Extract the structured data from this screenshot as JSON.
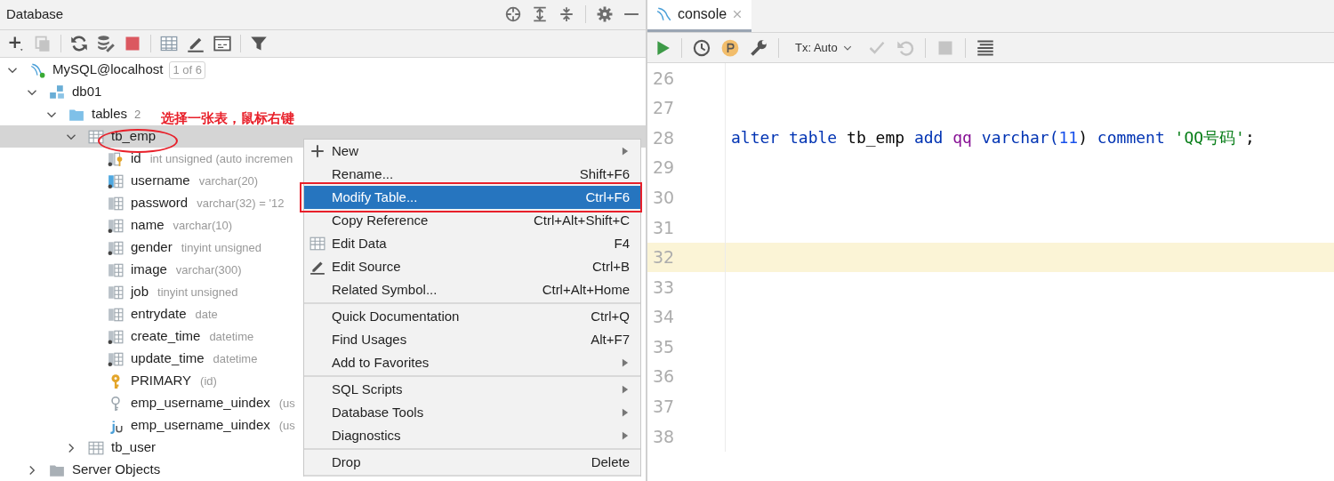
{
  "left_panel": {
    "title": "Database",
    "toolbar": [
      {
        "disabled": false
      },
      {
        "disabled": true
      },
      {
        "disabled": false
      },
      {
        "disabled": false
      },
      {
        "disabled": false
      },
      {
        "disabled": false
      },
      {
        "disabled": false
      },
      {
        "disabled": false
      },
      {
        "disabled": false
      }
    ],
    "tree": [
      {
        "kind": "connection",
        "label": "MySQL@localhost",
        "badge": "1 of 6",
        "expanded": true,
        "selected": false,
        "children": [
          {
            "kind": "schema",
            "label": "db01",
            "expanded": true,
            "selected": false,
            "children": [
              {
                "kind": "folder",
                "label": "tables",
                "count": "2",
                "expanded": true,
                "selected": false,
                "children": [
                  {
                    "kind": "table",
                    "label": "tb_emp",
                    "expanded": true,
                    "selected": true,
                    "children": [
                      {
                        "kind": "pk_column",
                        "label": "id",
                        "detail": "int unsigned (auto incremen",
                        "selected": false
                      },
                      {
                        "kind": "unique_column",
                        "label": "username",
                        "detail": "varchar(20)",
                        "selected": false
                      },
                      {
                        "kind": "column",
                        "label": "password",
                        "detail": "varchar(32) = '12",
                        "selected": false
                      },
                      {
                        "kind": "notnull_column",
                        "label": "name",
                        "detail": "varchar(10)",
                        "selected": false
                      },
                      {
                        "kind": "notnull_column",
                        "label": "gender",
                        "detail": "tinyint unsigned",
                        "selected": false
                      },
                      {
                        "kind": "column",
                        "label": "image",
                        "detail": "varchar(300)",
                        "selected": false
                      },
                      {
                        "kind": "column",
                        "label": "job",
                        "detail": "tinyint unsigned",
                        "selected": false
                      },
                      {
                        "kind": "column",
                        "label": "entrydate",
                        "detail": "date",
                        "selected": false
                      },
                      {
                        "kind": "notnull_column",
                        "label": "create_time",
                        "detail": "datetime",
                        "selected": false
                      },
                      {
                        "kind": "notnull_column",
                        "label": "update_time",
                        "detail": "datetime",
                        "selected": false
                      },
                      {
                        "kind": "primary_key",
                        "label": "PRIMARY",
                        "detail": "(id)",
                        "selected": false
                      },
                      {
                        "kind": "unique_key",
                        "label": "emp_username_uindex",
                        "detail": "(us",
                        "selected": false
                      },
                      {
                        "kind": "unique_index",
                        "label": "emp_username_uindex",
                        "detail": "(us",
                        "selected": false
                      }
                    ]
                  },
                  {
                    "kind": "table",
                    "label": "tb_user",
                    "expanded": false,
                    "selected": false
                  }
                ]
              }
            ]
          },
          {
            "kind": "folder_gray",
            "label": "Server Objects",
            "expanded": false,
            "selected": false
          }
        ]
      }
    ]
  },
  "annotation": {
    "text": "选择一张表，鼠标右键"
  },
  "context_menu": {
    "groups": [
      [
        {
          "kind": "add",
          "label": "New",
          "submenu": true,
          "selected": false
        },
        {
          "kind": "plain",
          "label": "Rename...",
          "shortcut": "Shift+F6",
          "submenu": false,
          "selected": false
        },
        {
          "kind": "plain",
          "label": "Modify Table...",
          "shortcut": "Ctrl+F6",
          "submenu": false,
          "selected": true
        },
        {
          "kind": "plain",
          "label": "Copy Reference",
          "shortcut": "Ctrl+Alt+Shift+C",
          "submenu": false,
          "selected": false
        },
        {
          "kind": "data",
          "label": "Edit Data",
          "shortcut": "F4",
          "submenu": false,
          "selected": false
        },
        {
          "kind": "source",
          "label": "Edit Source",
          "shortcut": "Ctrl+B",
          "submenu": false,
          "selected": false
        },
        {
          "kind": "plain",
          "label": "Related Symbol...",
          "shortcut": "Ctrl+Alt+Home",
          "submenu": false,
          "selected": false
        }
      ],
      [
        {
          "kind": "plain",
          "label": "Quick Documentation",
          "shortcut": "Ctrl+Q",
          "submenu": false,
          "selected": false
        },
        {
          "kind": "plain",
          "label": "Find Usages",
          "shortcut": "Alt+F7",
          "submenu": false,
          "selected": false
        },
        {
          "kind": "plain",
          "label": "Add to Favorites",
          "submenu": true,
          "selected": false
        }
      ],
      [
        {
          "kind": "plain",
          "label": "SQL Scripts",
          "submenu": true,
          "selected": false
        },
        {
          "kind": "plain",
          "label": "Database Tools",
          "submenu": true,
          "selected": false
        },
        {
          "kind": "plain",
          "label": "Diagnostics",
          "submenu": true,
          "selected": false
        }
      ],
      [
        {
          "kind": "plain",
          "label": "Drop",
          "shortcut": "Delete",
          "submenu": false,
          "selected": false
        }
      ]
    ]
  },
  "editor": {
    "tab": {
      "label": "console",
      "selected": true
    },
    "toolbar": {
      "tx_mode": "Tx: Auto"
    },
    "lines": [
      {
        "number": "26",
        "current": false
      },
      {
        "number": "27",
        "current": false
      },
      {
        "number": "28",
        "current": false,
        "tokens": [
          {
            "kind": "keyword",
            "text": "alter table"
          },
          {
            "kind": "plain",
            "text": "tb_emp"
          },
          {
            "kind": "keyword",
            "text": "add"
          },
          {
            "kind": "column",
            "text": "qq"
          },
          {
            "kind": "keyword",
            "text": "varchar("
          },
          {
            "kind": "number",
            "text": "11"
          },
          {
            "kind": "plain",
            "text": ")"
          },
          {
            "kind": "keyword",
            "text": "comment"
          },
          {
            "kind": "string",
            "text": "'QQ号码'"
          },
          {
            "kind": "plain",
            "text": ";"
          }
        ]
      },
      {
        "number": "29",
        "current": false
      },
      {
        "number": "30",
        "current": false
      },
      {
        "number": "31",
        "current": false
      },
      {
        "number": "32",
        "current": true
      },
      {
        "number": "33",
        "current": false
      },
      {
        "number": "34",
        "current": false
      },
      {
        "number": "35",
        "current": false
      },
      {
        "number": "36",
        "current": false
      },
      {
        "number": "37",
        "current": false
      },
      {
        "number": "38",
        "current": false
      }
    ]
  }
}
